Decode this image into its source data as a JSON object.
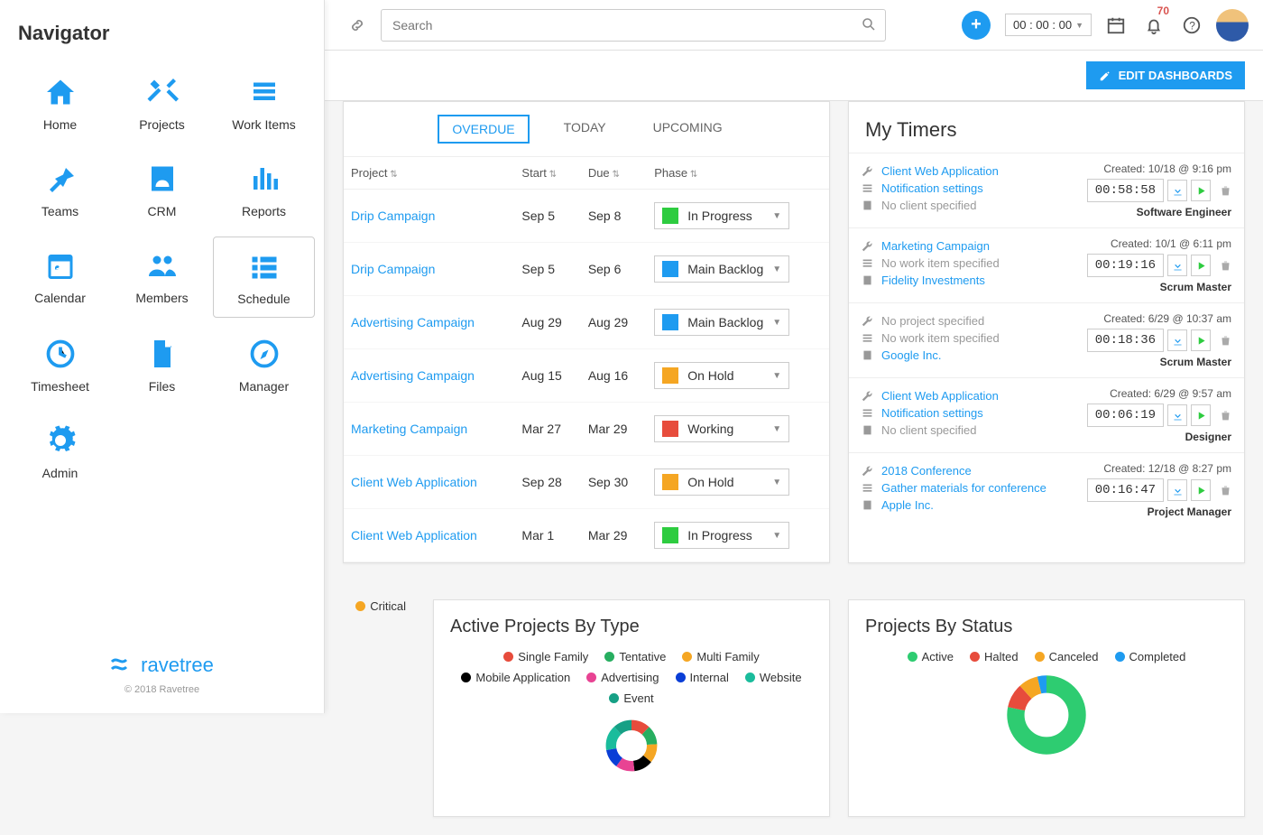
{
  "navigator": {
    "title": "Navigator",
    "items": [
      {
        "label": "Home",
        "icon": "home"
      },
      {
        "label": "Projects",
        "icon": "tools"
      },
      {
        "label": "Work Items",
        "icon": "list"
      },
      {
        "label": "Teams",
        "icon": "pin"
      },
      {
        "label": "CRM",
        "icon": "contact"
      },
      {
        "label": "Reports",
        "icon": "bars"
      },
      {
        "label": "Calendar",
        "icon": "calendar"
      },
      {
        "label": "Members",
        "icon": "members"
      },
      {
        "label": "Schedule",
        "icon": "schedule",
        "selected": true
      },
      {
        "label": "Timesheet",
        "icon": "clock"
      },
      {
        "label": "Files",
        "icon": "file"
      },
      {
        "label": "Manager",
        "icon": "compass"
      },
      {
        "label": "Admin",
        "icon": "gear"
      }
    ],
    "logo": "ravetree",
    "copyright": "© 2018 Ravetree"
  },
  "topbar": {
    "search_placeholder": "Search",
    "timer": "00 : 00 : 00",
    "notifications_count": "70"
  },
  "edit_button": "EDIT DASHBOARDS",
  "work_items": {
    "tabs": [
      "OVERDUE",
      "TODAY",
      "UPCOMING"
    ],
    "active_tab": "OVERDUE",
    "columns": [
      "Project",
      "Start",
      "Due",
      "Phase"
    ],
    "rows": [
      {
        "project": "Drip Campaign",
        "start": "Sep 5",
        "due": "Sep 8",
        "phase": "In Progress",
        "color": "#2ecc40"
      },
      {
        "project": "Drip Campaign",
        "start": "Sep 5",
        "due": "Sep 6",
        "phase": "Main Backlog",
        "color": "#1e9bf0"
      },
      {
        "project": "Advertising Campaign",
        "start": "Aug 29",
        "due": "Aug 29",
        "phase": "Main Backlog",
        "color": "#1e9bf0"
      },
      {
        "project": "Advertising Campaign",
        "start": "Aug 15",
        "due": "Aug 16",
        "phase": "On Hold",
        "color": "#f5a623"
      },
      {
        "project": "Marketing Campaign",
        "start": "Mar 27",
        "due": "Mar 29",
        "phase": "Working",
        "color": "#e74c3c"
      },
      {
        "project": "Client Web Application",
        "start": "Sep 28",
        "due": "Sep 30",
        "phase": "On Hold",
        "color": "#f5a623"
      },
      {
        "project": "Client Web Application",
        "start": "Mar 1",
        "due": "Mar 29",
        "phase": "In Progress",
        "color": "#2ecc40"
      }
    ]
  },
  "timers": {
    "title": "My Timers",
    "items": [
      {
        "project": "Client Web Application",
        "workitem": "Notification settings",
        "client": "No client specified",
        "client_muted": true,
        "created": "Created: 10/18 @ 9:16 pm",
        "elapsed": "00:58:58",
        "role": "Software Engineer"
      },
      {
        "project": "Marketing Campaign",
        "workitem": "No work item specified",
        "workitem_muted": true,
        "client": "Fidelity Investments",
        "created": "Created: 10/1 @ 6:11 pm",
        "elapsed": "00:19:16",
        "role": "Scrum Master"
      },
      {
        "project": "No project specified",
        "project_muted": true,
        "workitem": "No work item specified",
        "workitem_muted": true,
        "client": "Google Inc.",
        "created": "Created: 6/29 @ 10:37 am",
        "elapsed": "00:18:36",
        "role": "Scrum Master"
      },
      {
        "project": "Client Web Application",
        "workitem": "Notification settings",
        "client": "No client specified",
        "client_muted": true,
        "created": "Created: 6/29 @ 9:57 am",
        "elapsed": "00:06:19",
        "role": "Designer"
      },
      {
        "project": "2018 Conference",
        "workitem": "Gather materials for conference",
        "client": "Apple Inc.",
        "created": "Created: 12/18 @ 8:27 pm",
        "elapsed": "00:16:47",
        "role": "Project Manager"
      }
    ]
  },
  "critical_label": "Critical",
  "active_projects": {
    "title": "Active Projects By Type",
    "legend": [
      {
        "label": "Single Family",
        "color": "#e74c3c"
      },
      {
        "label": "Tentative",
        "color": "#27ae60"
      },
      {
        "label": "Multi Family",
        "color": "#f5a623"
      },
      {
        "label": "Mobile Application",
        "color": "#000000"
      },
      {
        "label": "Advertising",
        "color": "#e84393"
      },
      {
        "label": "Internal",
        "color": "#0a3ed6"
      },
      {
        "label": "Website",
        "color": "#1abc9c"
      },
      {
        "label": "Event",
        "color": "#16a085"
      }
    ]
  },
  "projects_status": {
    "title": "Projects By Status",
    "legend": [
      {
        "label": "Active",
        "color": "#2ecc71"
      },
      {
        "label": "Halted",
        "color": "#e74c3c"
      },
      {
        "label": "Canceled",
        "color": "#f5a623"
      },
      {
        "label": "Completed",
        "color": "#1e9bf0"
      }
    ]
  },
  "chart_data": [
    {
      "type": "pie",
      "title": "Active Projects By Type",
      "series": [
        {
          "name": "Single Family",
          "value": 12
        },
        {
          "name": "Tentative",
          "value": 12
        },
        {
          "name": "Multi Family",
          "value": 12
        },
        {
          "name": "Mobile Application",
          "value": 12
        },
        {
          "name": "Advertising",
          "value": 12
        },
        {
          "name": "Internal",
          "value": 12
        },
        {
          "name": "Website",
          "value": 16
        },
        {
          "name": "Event",
          "value": 12
        }
      ]
    },
    {
      "type": "pie",
      "title": "Projects By Status",
      "series": [
        {
          "name": "Active",
          "value": 78
        },
        {
          "name": "Halted",
          "value": 10
        },
        {
          "name": "Canceled",
          "value": 8
        },
        {
          "name": "Completed",
          "value": 4
        }
      ]
    }
  ]
}
